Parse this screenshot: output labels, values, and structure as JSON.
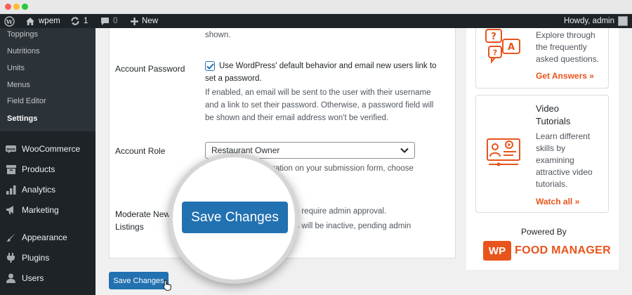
{
  "admin_bar": {
    "site_name": "wpem",
    "updates_count": "1",
    "comments_count": "0",
    "new_label": "New",
    "howdy": "Howdy, admin"
  },
  "sidebar": {
    "submenu": [
      "Toppings",
      "Nutritions",
      "Units",
      "Menus",
      "Field Editor",
      "Settings"
    ],
    "menu": [
      {
        "label": "WooCommerce",
        "icon": "woocommerce-icon"
      },
      {
        "label": "Products",
        "icon": "products-icon"
      },
      {
        "label": "Analytics",
        "icon": "analytics-icon"
      },
      {
        "label": "Marketing",
        "icon": "marketing-icon"
      },
      {
        "label": "Appearance",
        "icon": "appearance-icon"
      },
      {
        "label": "Plugins",
        "icon": "plugins-icon"
      },
      {
        "label": "Users",
        "icon": "users-icon"
      }
    ]
  },
  "form": {
    "top_text": "shown.",
    "account_password": {
      "label": "Account Password",
      "checkbox_text_1": "Use WordPress' default behavior and email new users link to",
      "checkbox_text_2": "set a password.",
      "desc_1": "If enabled, an email will be sent to the user with their username",
      "desc_2": "and a link to set their password. Otherwise, a password field will",
      "desc_3": "be shown and their email address won't be verified."
    },
    "account_role": {
      "label": "Account Role",
      "selected": "Restaurant Owner",
      "desc_1": "registration on your submission form, choose"
    },
    "moderate": {
      "label_1": "Moderate New",
      "label_2": "Listings",
      "desc_1": "ns require admin approval.",
      "desc_2": "ns will be inactive, pending admin"
    },
    "save_label": "Save Changes"
  },
  "magnifier": {
    "save_label": "Save Changes"
  },
  "right": {
    "faq": {
      "text": [
        "Explore through",
        "the frequently",
        "asked questions."
      ],
      "link": "Get Answers »"
    },
    "video": {
      "title_1": "Video",
      "title_2": "Tutorials",
      "text": [
        "Learn different",
        "skills by",
        "examining",
        "attractive video",
        "tutorials."
      ],
      "link": "Watch all »"
    },
    "powered_by": "Powered By",
    "logo_badge": "WP",
    "logo_text": "FOOD MANAGER"
  },
  "accent_color": "#e8541c",
  "primary_color": "#2271b1"
}
